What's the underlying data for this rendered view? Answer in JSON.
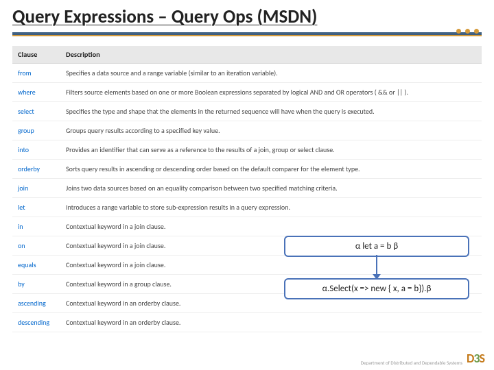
{
  "title": "Query Expressions – Query Ops (MSDN)",
  "table": {
    "headers": {
      "col1": "Clause",
      "col2": "Description"
    },
    "rows": [
      {
        "clause": "from",
        "desc": "Specifies a data source and a range variable (similar to an iteration variable)."
      },
      {
        "clause": "where",
        "desc": "Filters source elements based on one or more Boolean expressions separated by logical AND and OR operators ( && or || )."
      },
      {
        "clause": "select",
        "desc": "Specifies the type and shape that the elements in the returned sequence will have when the query is executed."
      },
      {
        "clause": "group",
        "desc": "Groups query results according to a specified key value."
      },
      {
        "clause": "into",
        "desc": "Provides an identifier that can serve as a reference to the results of a join, group or select clause."
      },
      {
        "clause": "orderby",
        "desc": "Sorts query results in ascending or descending order based on the default comparer for the element type."
      },
      {
        "clause": "join",
        "desc": "Joins two data sources based on an equality comparison between two specified matching criteria."
      },
      {
        "clause": "let",
        "desc": "Introduces a range variable to store sub-expression results in a query expression."
      },
      {
        "clause": "in",
        "desc": "Contextual keyword in a join clause."
      },
      {
        "clause": "on",
        "desc": "Contextual keyword in a join clause."
      },
      {
        "clause": "equals",
        "desc": "Contextual keyword in a join clause."
      },
      {
        "clause": "by",
        "desc": "Contextual keyword in a group clause."
      },
      {
        "clause": "ascending",
        "desc": "Contextual keyword in an orderby clause."
      },
      {
        "clause": "descending",
        "desc": "Contextual keyword in an orderby clause."
      }
    ]
  },
  "callouts": {
    "top": "α let a = b β",
    "bottom": "α.Select(x => new { x, a = b}).β"
  },
  "footer": {
    "dept": "Department of\nDistributed and\nDependable\nSystems",
    "logo_d": "D",
    "logo_3": "3",
    "logo_s": "S"
  }
}
